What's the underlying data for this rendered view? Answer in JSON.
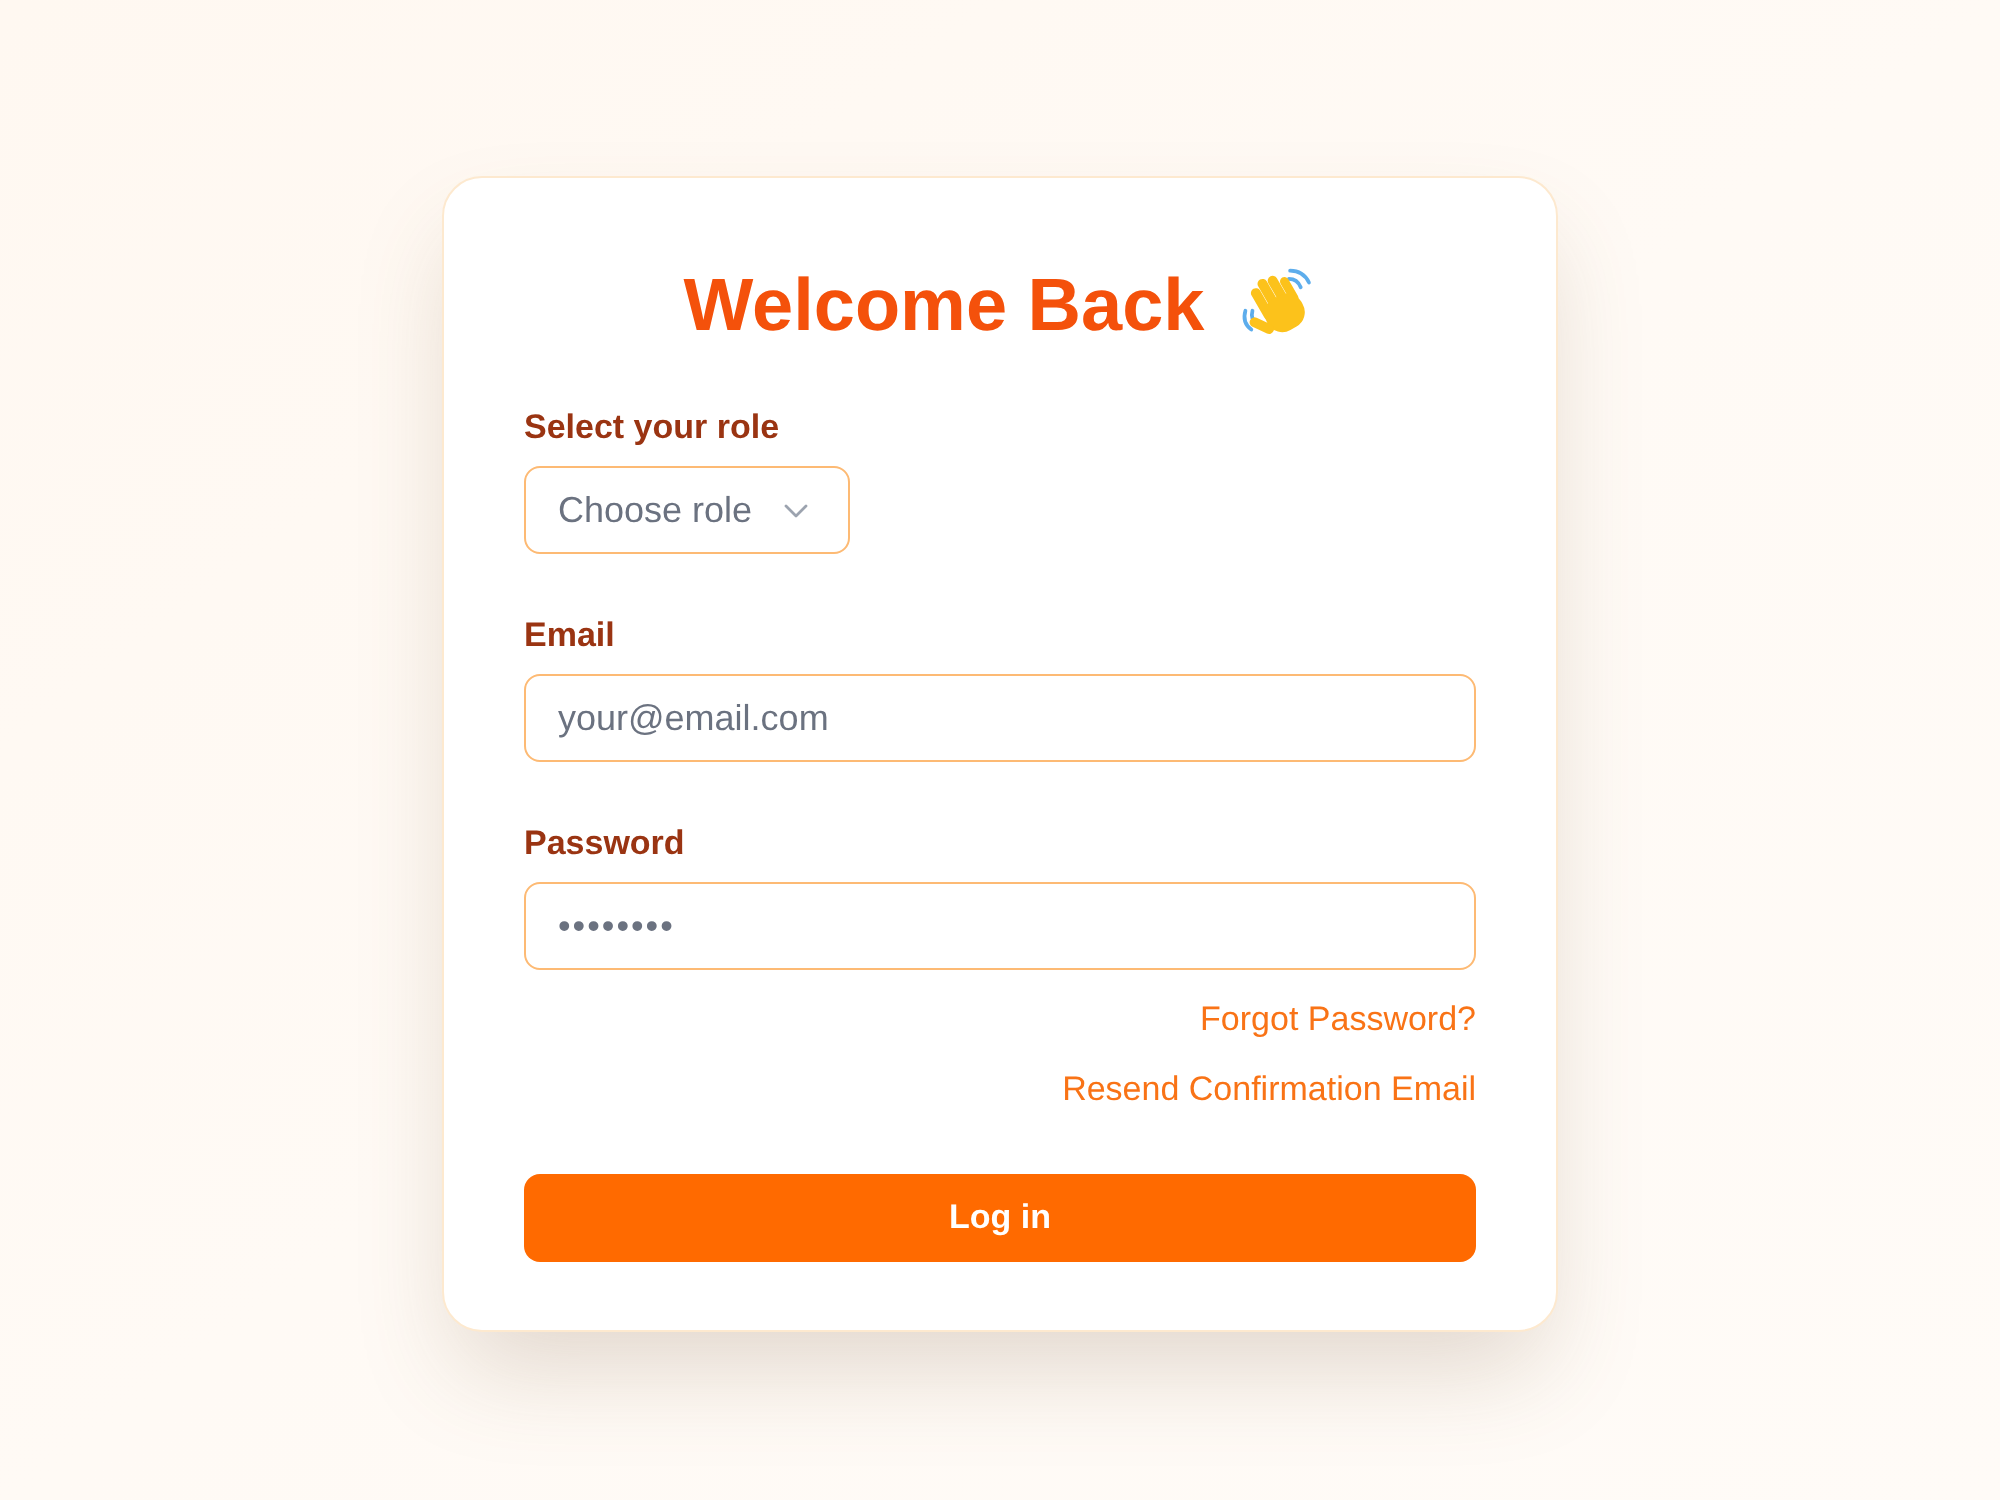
{
  "title": "Welcome Back",
  "role": {
    "label": "Select your role",
    "placeholder": "Choose role"
  },
  "email": {
    "label": "Email",
    "placeholder": "your@email.com"
  },
  "password": {
    "label": "Password",
    "value": "••••••••"
  },
  "links": [
    "Forgot Password?",
    "Resend Confirmation Email"
  ],
  "login_button": "Log in"
}
